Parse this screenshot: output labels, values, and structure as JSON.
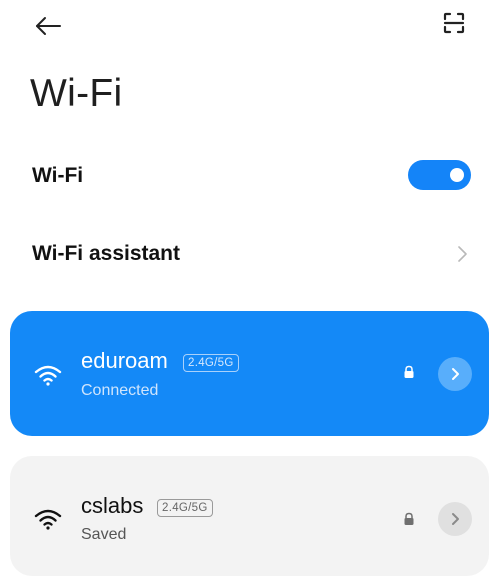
{
  "header": {
    "back_icon": "arrow-left-icon",
    "scan_icon": "qr-scan-icon",
    "title": "Wi-Fi"
  },
  "settings": {
    "wifi_toggle_label": "Wi-Fi",
    "wifi_enabled": true,
    "assistant_label": "Wi-Fi assistant"
  },
  "networks": [
    {
      "name": "eduroam",
      "band": "2.4G/5G",
      "status": "Connected",
      "secured": true,
      "connected": true
    },
    {
      "name": "cslabs",
      "band": "2.4G/5G",
      "status": "Saved",
      "secured": true,
      "connected": false
    }
  ],
  "colors": {
    "accent": "#1489f7",
    "toggle_on": "#1484f8",
    "saved_card_bg": "#f3f3f3",
    "connected_text": "#ffffff",
    "connected_subtext": "#cfe5fd",
    "saved_subtext": "#555555"
  }
}
